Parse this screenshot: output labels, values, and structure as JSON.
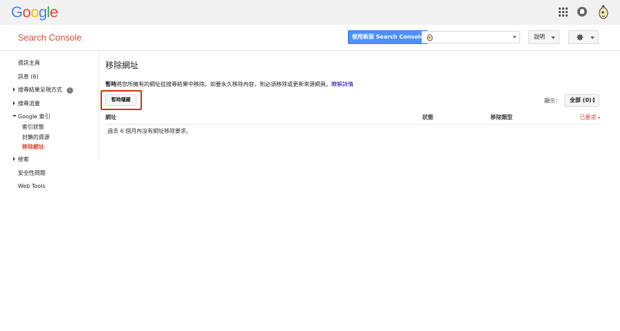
{
  "logo": {
    "text": "Google",
    "letters": [
      {
        "ch": "G",
        "color": "#4285f4"
      },
      {
        "ch": "o",
        "color": "#ea4335"
      },
      {
        "ch": "o",
        "color": "#fbbc05"
      },
      {
        "ch": "g",
        "color": "#4285f4"
      },
      {
        "ch": "l",
        "color": "#34a853"
      },
      {
        "ch": "e",
        "color": "#ea4335"
      }
    ]
  },
  "topbar": {
    "icons": [
      "apps-icon",
      "notifications-icon",
      "account-avatar-icon"
    ]
  },
  "header": {
    "product_title": "Search Console",
    "new_sc_button": "使用新版 Search Console",
    "site_select_value": "",
    "help_label": "說明",
    "settings_icon": "gear-icon"
  },
  "sidebar": {
    "items": {
      "dashboard": "資訊主頁",
      "messages": "訊息 (6)",
      "search_appearance": "搜尋結果呈現方式",
      "search_traffic": "搜尋流量",
      "google_index": "Google 索引",
      "crawl": "檢索",
      "security_issues": "安全性問題",
      "web_tools": "Web Tools"
    },
    "sub_items": {
      "index_status": "索引狀態",
      "blocked_resources": "封鎖的資源",
      "remove_urls": "移除網址"
    }
  },
  "main": {
    "title": "移除網址",
    "desc_bold": "暫時",
    "desc_text": "將您所擁有的網址從搜尋結果中移除。如要永久移除內容，則必須移除或更新來源網頁。",
    "desc_link": "瞭解詳情",
    "temp_hide_button": "暫時隱藏",
    "show_label": "顯示：",
    "filter_value": "全部 (0)",
    "table": {
      "columns": {
        "url": "網址",
        "status": "狀態",
        "type": "移除類型",
        "requested": "已要求"
      },
      "empty_message": "過去 6 個月內沒有網址移除要求。"
    }
  },
  "colors": {
    "accent_red": "#dd4b39",
    "button_blue": "#4d90fe",
    "link": "#1a0dab",
    "highlight_box": "#dd2c00"
  }
}
